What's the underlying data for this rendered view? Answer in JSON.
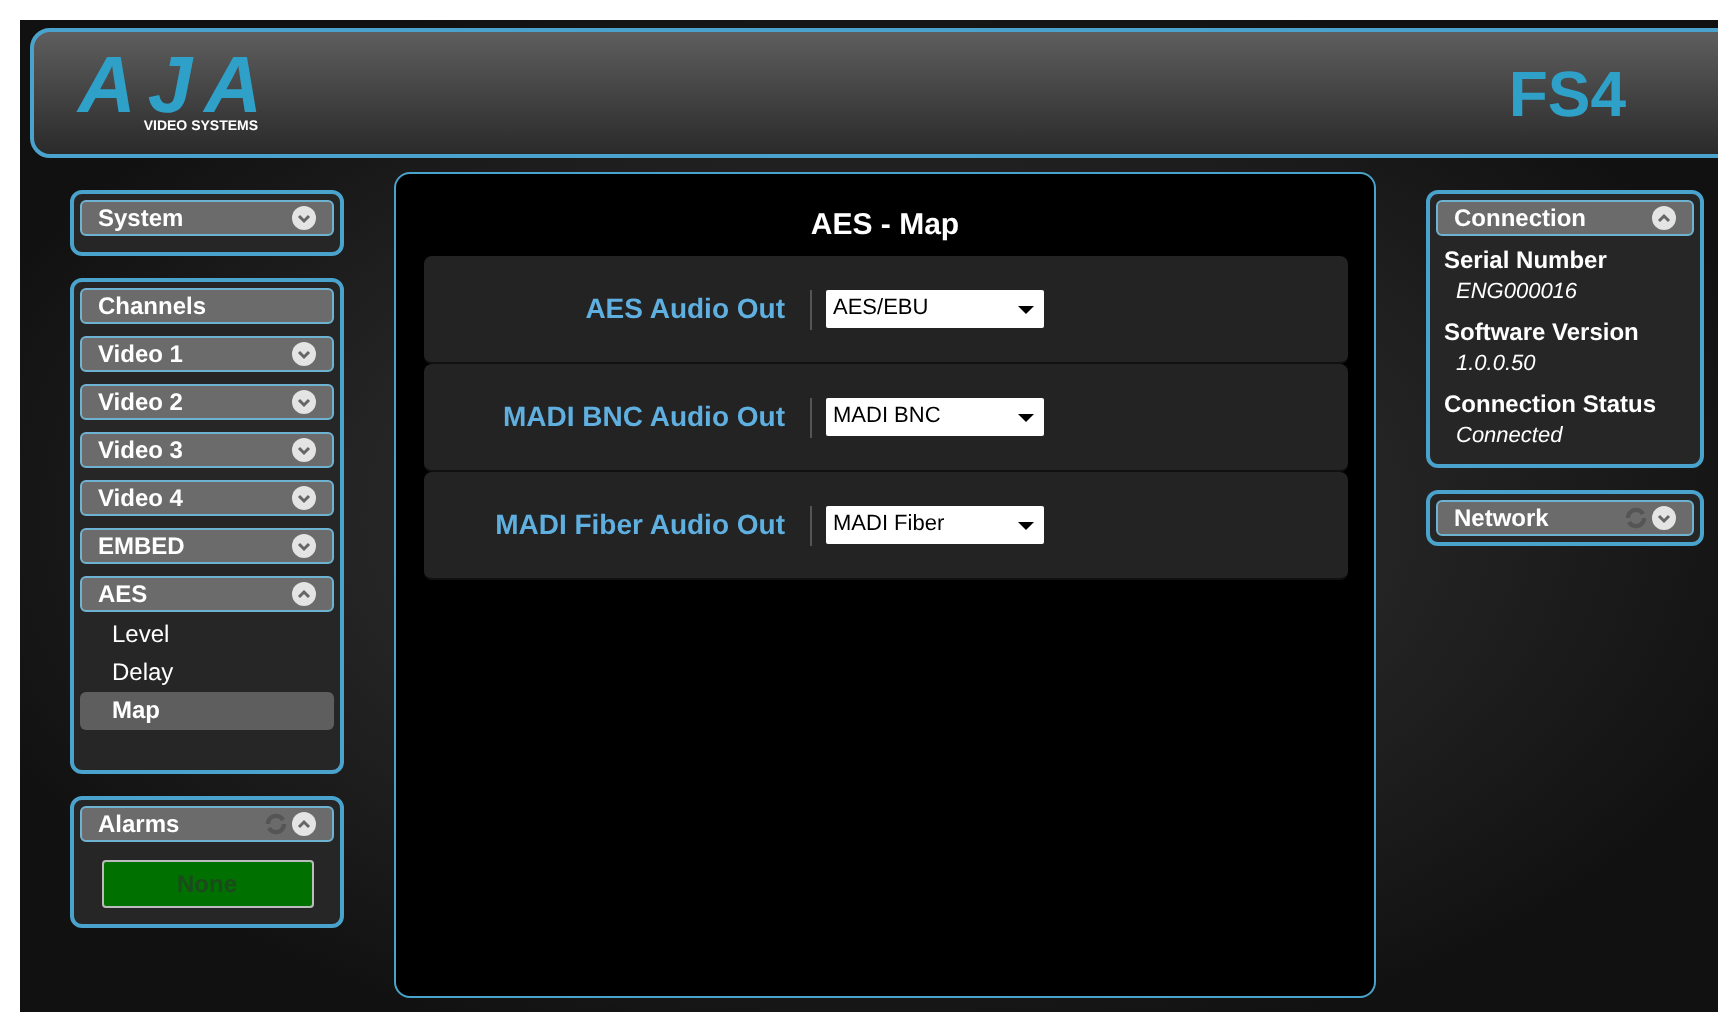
{
  "header": {
    "logo": "AJA",
    "logo_subtitle": "VIDEO SYSTEMS",
    "device": "FS4"
  },
  "system": {
    "title": "System",
    "expanded": false
  },
  "channels": {
    "title": "Channels",
    "items": [
      {
        "label": "Video 1",
        "expanded": false
      },
      {
        "label": "Video 2",
        "expanded": false
      },
      {
        "label": "Video 3",
        "expanded": false
      },
      {
        "label": "Video 4",
        "expanded": false
      },
      {
        "label": "EMBED",
        "expanded": false
      },
      {
        "label": "AES",
        "expanded": true,
        "children": [
          {
            "label": "Level",
            "selected": false
          },
          {
            "label": "Delay",
            "selected": false
          },
          {
            "label": "Map",
            "selected": true
          }
        ]
      }
    ]
  },
  "alarms": {
    "title": "Alarms",
    "expanded": true,
    "status": "None"
  },
  "main": {
    "title": "AES - Map",
    "rows": [
      {
        "label": "AES Audio Out",
        "value": "AES/EBU"
      },
      {
        "label": "MADI BNC Audio Out",
        "value": "MADI BNC"
      },
      {
        "label": "MADI Fiber Audio Out",
        "value": "MADI Fiber"
      }
    ]
  },
  "connection": {
    "title": "Connection",
    "expanded": true,
    "fields": [
      {
        "label": "Serial Number",
        "value": "ENG000016"
      },
      {
        "label": "Software Version",
        "value": "1.0.0.50"
      },
      {
        "label": "Connection Status",
        "value": "Connected"
      }
    ]
  },
  "network": {
    "title": "Network",
    "expanded": false
  }
}
